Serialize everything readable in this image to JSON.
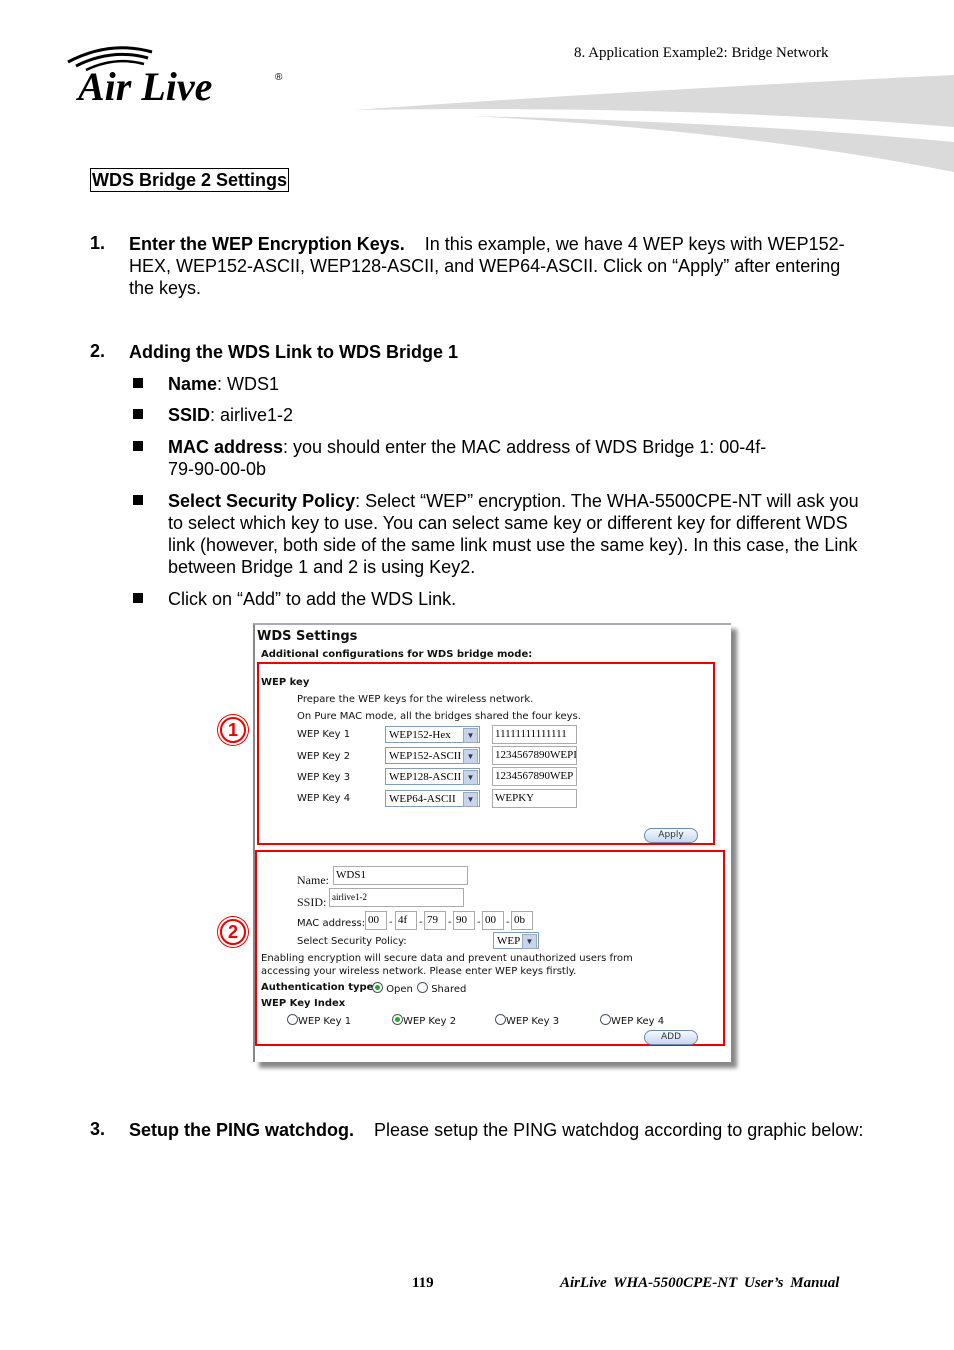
{
  "header": {
    "chapter": "8.  Application  Example2:  Bridge  Network",
    "logo_text": "Air Live",
    "logo_mark": "®"
  },
  "section_title": "WDS Bridge 2 Settings",
  "steps": [
    {
      "number": "1.",
      "title": "Enter the WEP Encryption Keys.",
      "text": "In this example, we have 4 WEP keys with WEP152-HEX, WEP152-ASCII, WEP128-ASCII, and WEP64-ASCII.    Click on “Apply” after entering the keys."
    },
    {
      "number": "2.",
      "title": "Adding the WDS Link to WDS Bridge 1",
      "bullets": [
        {
          "label": "Name",
          "text": ": WDS1"
        },
        {
          "label": "SSID",
          "text": ": airlive1-2"
        },
        {
          "label": "MAC address",
          "text": ": you should enter the MAC address of WDS Bridge 1: 00-4f-79-90-00-0b"
        },
        {
          "label": "Select Security Policy",
          "text": ":    Select “WEP” encryption.    The WHA-5500CPE-NT will ask you to select which key to use.    You can select same key or different key for different WDS link (however, both side of the same link must use the same key).    In this case, the Link between Bridge 1 and 2 is using Key2."
        },
        {
          "label": "",
          "text": "Click on “Add” to add the WDS Link."
        }
      ]
    },
    {
      "number": "3.",
      "title": "Setup the PING watchdog.",
      "text": "Please setup the PING watchdog according to graphic below:"
    }
  ],
  "figure": {
    "title": "WDS Settings",
    "subtitle": "Additional configurations for WDS bridge mode:",
    "callouts": [
      "1",
      "2"
    ],
    "wep_key": {
      "heading": "WEP key",
      "desc1": "Prepare the WEP keys for the wireless network.",
      "desc2": "On Pure MAC mode, all the bridges shared the four keys.",
      "rows": [
        {
          "label": "WEP Key 1",
          "type": "WEP152-Hex",
          "value": "11111111111111"
        },
        {
          "label": "WEP Key 2",
          "type": "WEP152-ASCII",
          "value": "1234567890WEPI"
        },
        {
          "label": "WEP Key 3",
          "type": "WEP128-ASCII",
          "value": "1234567890WEP"
        },
        {
          "label": "WEP Key 4",
          "type": "WEP64-ASCII",
          "value": "WEPKY"
        }
      ],
      "apply_label": "Apply"
    },
    "link": {
      "name_label": "Name:",
      "name_value": "WDS1",
      "ssid_label": "SSID:",
      "ssid_value": "airlive1-2",
      "mac_label": "MAC address:",
      "mac": [
        "00",
        "4f",
        "79",
        "90",
        "00",
        "0b"
      ],
      "policy_label": "Select Security Policy:",
      "policy_value": "WEP",
      "note": "Enabling encryption will secure data and prevent unauthorized users from",
      "note2": "accessing your wireless network. Please enter WEP keys firstly.",
      "auth_label": "Authentication type",
      "auth_options": [
        "Open",
        "Shared"
      ],
      "auth_selected": "Open",
      "key_index_label": "WEP Key Index",
      "key_index_options": [
        "WEP Key 1",
        "WEP Key 2",
        "WEP Key 3",
        "WEP Key 4"
      ],
      "key_index_selected": "WEP Key 2",
      "add_label": "ADD"
    }
  },
  "footer": {
    "page_number": "119",
    "manual_title": "AirLive  WHA-5500CPE-NT  User’s  Manual"
  }
}
